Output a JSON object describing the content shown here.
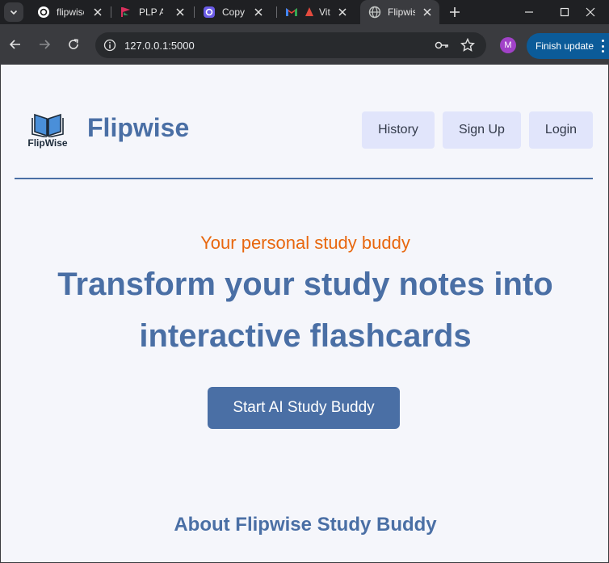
{
  "browser": {
    "tabs": [
      {
        "title": "flipwise",
        "icon": "openai-icon"
      },
      {
        "title": "PLP Academy",
        "icon": "plp-icon"
      },
      {
        "title": "Copy",
        "icon": "copy-app-icon"
      },
      {
        "title": "Vit",
        "icon": "gmail-icon"
      },
      {
        "title": "Flipwise",
        "icon": "globe-icon",
        "active": true
      }
    ],
    "url": "127.0.0.1:5000",
    "profile_initial": "M",
    "finish_update_label": "Finish update",
    "colors": {
      "accent": "#0b5b99",
      "profile": "#a142c8"
    }
  },
  "header": {
    "logo_text": "FlipWise",
    "brand": "Flipwise",
    "nav": [
      {
        "label": "History"
      },
      {
        "label": "Sign Up"
      },
      {
        "label": "Login"
      }
    ]
  },
  "hero": {
    "tagline": "Your personal study buddy",
    "headline": "Transform your study notes into interactive flashcards",
    "cta_label": "Start AI Study Buddy"
  },
  "about": {
    "title": "About Flipwise Study Buddy"
  },
  "colors": {
    "primary": "#4a6fa5",
    "tagline": "#e8670e",
    "nav_bg": "#e1e5fb",
    "page_bg": "#f5f6fb"
  }
}
